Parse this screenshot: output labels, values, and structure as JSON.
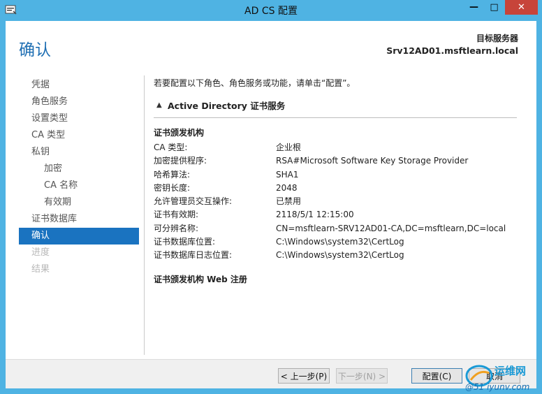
{
  "window": {
    "title": "AD CS 配置",
    "controls": {
      "minimize": "—",
      "maximize": "□",
      "close": "✕"
    }
  },
  "header": {
    "page_title": "确认",
    "destination_label": "目标服务器",
    "destination_value": "Srv12AD01.msftlearn.local"
  },
  "nav": {
    "items": [
      {
        "label": "凭据",
        "state": "normal",
        "level": 0
      },
      {
        "label": "角色服务",
        "state": "normal",
        "level": 0
      },
      {
        "label": "设置类型",
        "state": "normal",
        "level": 0
      },
      {
        "label": "CA 类型",
        "state": "normal",
        "level": 0
      },
      {
        "label": "私钥",
        "state": "normal",
        "level": 0
      },
      {
        "label": "加密",
        "state": "normal",
        "level": 1
      },
      {
        "label": "CA 名称",
        "state": "normal",
        "level": 1
      },
      {
        "label": "有效期",
        "state": "normal",
        "level": 1
      },
      {
        "label": "证书数据库",
        "state": "normal",
        "level": 0
      },
      {
        "label": "确认",
        "state": "active",
        "level": 0
      },
      {
        "label": "进度",
        "state": "disabled",
        "level": 0
      },
      {
        "label": "结果",
        "state": "disabled",
        "level": 0
      }
    ]
  },
  "content": {
    "intro": "若要配置以下角色、角色服务或功能，请单击“配置”。",
    "section_title": "Active Directory 证书服务",
    "group1_title": "证书颁发机构",
    "properties": [
      {
        "label": "CA 类型:",
        "value": "企业根"
      },
      {
        "label": "加密提供程序:",
        "value": "RSA#Microsoft Software Key Storage Provider"
      },
      {
        "label": "哈希算法:",
        "value": "SHA1"
      },
      {
        "label": "密钥长度:",
        "value": "2048"
      },
      {
        "label": "允许管理员交互操作:",
        "value": "已禁用"
      },
      {
        "label": "证书有效期:",
        "value": "2118/5/1 12:15:00"
      },
      {
        "label": "可分辨名称:",
        "value": "CN=msftlearn-SRV12AD01-CA,DC=msftlearn,DC=local"
      },
      {
        "label": "证书数据库位置:",
        "value": "C:\\Windows\\system32\\CertLog"
      },
      {
        "label": "证书数据库日志位置:",
        "value": "C:\\Windows\\system32\\CertLog"
      }
    ],
    "group2_title": "证书颁发机构 Web 注册"
  },
  "footer": {
    "prev_label": "< 上一步(P)",
    "next_label": "下一步(N) >",
    "configure_label": "配置(C)",
    "cancel_label": "取消"
  },
  "watermark": {
    "text": "运维网",
    "subtext": "@51 iyunv.com"
  },
  "colors": {
    "frame": "#4fb3e3",
    "accent": "#1a73c0",
    "title_blue": "#1f6fb3",
    "close_red": "#c7443a"
  }
}
